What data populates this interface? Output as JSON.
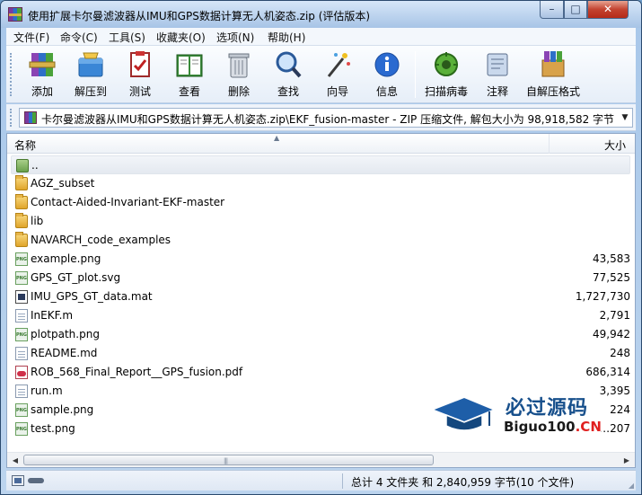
{
  "window": {
    "title": "使用扩展卡尔曼滤波器从IMU和GPS数据计算无人机姿态.zip (评估版本)",
    "controls": {
      "minimize": "–",
      "maximize": "□",
      "close": "✕"
    }
  },
  "menu": [
    "文件(F)",
    "命令(C)",
    "工具(S)",
    "收藏夹(O)",
    "选项(N)",
    "帮助(H)"
  ],
  "toolbar": [
    {
      "label": "添加",
      "icon": "add-archive-icon"
    },
    {
      "label": "解压到",
      "icon": "extract-to-icon"
    },
    {
      "label": "测试",
      "icon": "test-icon"
    },
    {
      "label": "查看",
      "icon": "view-book-icon"
    },
    {
      "label": "删除",
      "icon": "trash-icon"
    },
    {
      "label": "查找",
      "icon": "magnifier-icon"
    },
    {
      "label": "向导",
      "icon": "wizard-wand-icon"
    },
    {
      "label": "信息",
      "icon": "info-icon"
    },
    {
      "label": "扫描病毒",
      "icon": "virus-scan-icon"
    },
    {
      "label": "注释",
      "icon": "comment-icon"
    },
    {
      "label": "自解压格式",
      "icon": "sfx-icon"
    }
  ],
  "path": {
    "text": "卡尔曼滤波器从IMU和GPS数据计算无人机姿态.zip\\EKF_fusion-master - ZIP 压缩文件, 解包大小为 98,918,582 字节",
    "dropdown_arrow": "▼"
  },
  "columns": {
    "name": "名称",
    "size": "大小",
    "sort_indicator": "▲"
  },
  "files": [
    {
      "name": "..",
      "size": "",
      "type": "up"
    },
    {
      "name": "AGZ_subset",
      "size": "",
      "type": "folder"
    },
    {
      "name": "Contact-Aided-Invariant-EKF-master",
      "size": "",
      "type": "folder"
    },
    {
      "name": "lib",
      "size": "",
      "type": "folder"
    },
    {
      "name": "NAVARCH_code_examples",
      "size": "",
      "type": "folder"
    },
    {
      "name": "example.png",
      "size": "43,583",
      "type": "png"
    },
    {
      "name": "GPS_GT_plot.svg",
      "size": "77,525",
      "type": "png"
    },
    {
      "name": "IMU_GPS_GT_data.mat",
      "size": "1,727,730",
      "type": "mat"
    },
    {
      "name": "InEKF.m",
      "size": "2,791",
      "type": "doc"
    },
    {
      "name": "plotpath.png",
      "size": "49,942",
      "type": "png"
    },
    {
      "name": "README.md",
      "size": "248",
      "type": "doc"
    },
    {
      "name": "ROB_568_Final_Report__GPS_fusion.pdf",
      "size": "686,314",
      "type": "pdf"
    },
    {
      "name": "run.m",
      "size": "3,395",
      "type": "doc"
    },
    {
      "name": "sample.png",
      "size": "224",
      "type": "png"
    },
    {
      "name": "test.png",
      "size": "…207",
      "type": "png"
    }
  ],
  "status": {
    "text": "总计 4 文件夹 和 2,840,959 字节(10 个文件)"
  },
  "watermark": {
    "cn": "必过源码",
    "en_main": "Biguo100",
    "en_suffix": ".CN"
  },
  "colors": {
    "title_bar": "#a7c4e6",
    "close_button": "#c34330",
    "selection": "#e4e9f0",
    "watermark_blue": "#18508c",
    "watermark_red": "#e02020"
  }
}
